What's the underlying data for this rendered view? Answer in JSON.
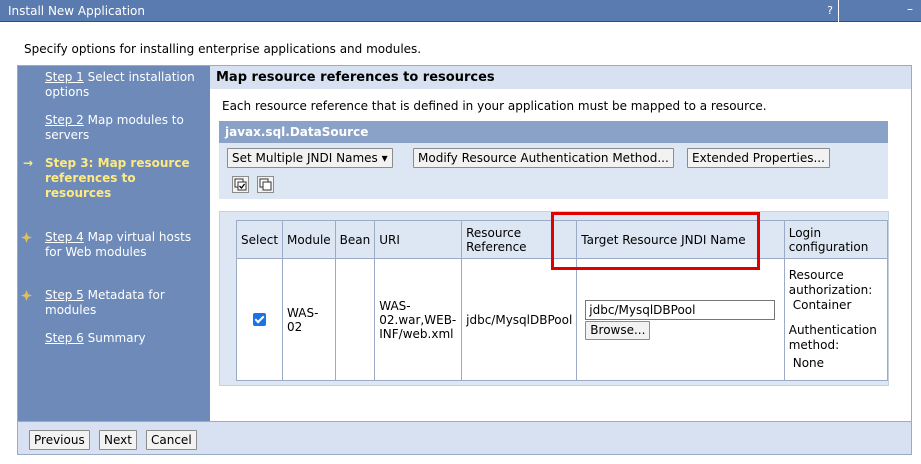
{
  "window": {
    "title": "Install New Application",
    "help_glyph": "?",
    "minimize_glyph": "–"
  },
  "intro": "Specify options for installing enterprise applications and modules.",
  "steps": [
    {
      "num": "Step 1",
      "label": "Select installation options",
      "current": false
    },
    {
      "num": "Step 2",
      "label": "Map modules to servers",
      "current": false
    },
    {
      "num": "Step 3:",
      "label": "Map resource references to resources",
      "current": true
    },
    {
      "num": "Step 4",
      "label": "Map virtual hosts for Web modules",
      "current": false
    },
    {
      "num": "Step 5",
      "label": "Metadata for modules",
      "current": false
    },
    {
      "num": "Step 6",
      "label": "Summary",
      "current": false
    }
  ],
  "current_marker": "→",
  "content": {
    "heading": "Map resource references to resources",
    "description": "Each resource reference that is defined in your application must be mapped to a resource.",
    "section_title": "javax.sql.DataSource",
    "toolbar": {
      "set_jndi_label": "Set Multiple JNDI Names ▾",
      "modify_auth_label": "Modify Resource Authentication Method...",
      "extended_label": "Extended Properties..."
    },
    "table": {
      "headers": [
        "Select",
        "Module",
        "Bean",
        "URI",
        "Resource Reference",
        "Target Resource JNDI Name",
        "Login configuration"
      ],
      "row": {
        "module": "WAS-02",
        "bean": "",
        "uri": "WAS-02.war,WEB-INF/web.xml",
        "resource_reference": "jdbc/MysqlDBPool",
        "target_jndi_value": "jdbc/MysqlDBPool",
        "browse_label": "Browse...",
        "login_auth_label": "Resource authorization:",
        "login_auth_value": "Container",
        "login_method_label": "Authentication method:",
        "login_method_value": "None"
      }
    }
  },
  "footer": {
    "previous_label": "Previous",
    "next_label": "Next",
    "cancel_label": "Cancel"
  },
  "colors": {
    "titlebar": "#5a7bb0",
    "steps_panel": "#6d8ab8",
    "current_step": "#ffea80",
    "section_title": "#8ba2c8",
    "highlight_box": "#e00000",
    "checkbox": "#1a73e8"
  }
}
